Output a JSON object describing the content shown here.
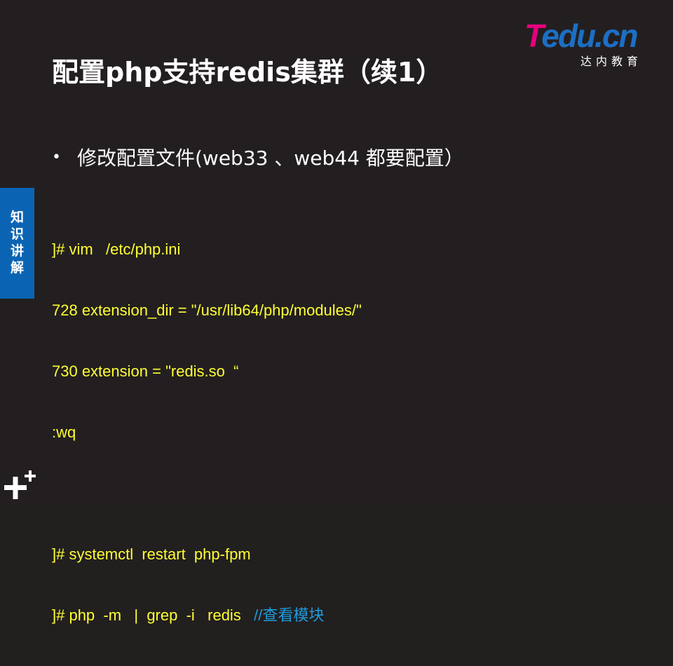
{
  "title": "配置php支持redis集群（续1）",
  "logo": {
    "brand_t": "T",
    "brand_rest": "edu.cn",
    "sub": "达内教育"
  },
  "bullet": {
    "marker": "•",
    "text": "修改配置文件(web33 、web44 都要配置）"
  },
  "side_tab": {
    "chars": [
      "知",
      "识",
      "讲",
      "解"
    ]
  },
  "code": {
    "lines": [
      "]# vim   /etc/php.ini",
      "728 extension_dir = \"/usr/lib64/php/modules/\"",
      "730 extension = \"redis.so  “",
      ":wq"
    ],
    "lines2": [
      "]# systemctl  restart  php-fpm"
    ],
    "last_command": "]# php  -m   |  grep  -i   redis   ",
    "last_comment": "//查看模块"
  },
  "colors": {
    "background": "#231f20",
    "code": "#ffff33",
    "comment": "#1e9bdc",
    "side_tab": "#0b64b3",
    "logo_magenta": "#e6007e",
    "logo_blue": "#1c6fc4"
  },
  "icons": {
    "corner": "plus-plus-icon"
  }
}
